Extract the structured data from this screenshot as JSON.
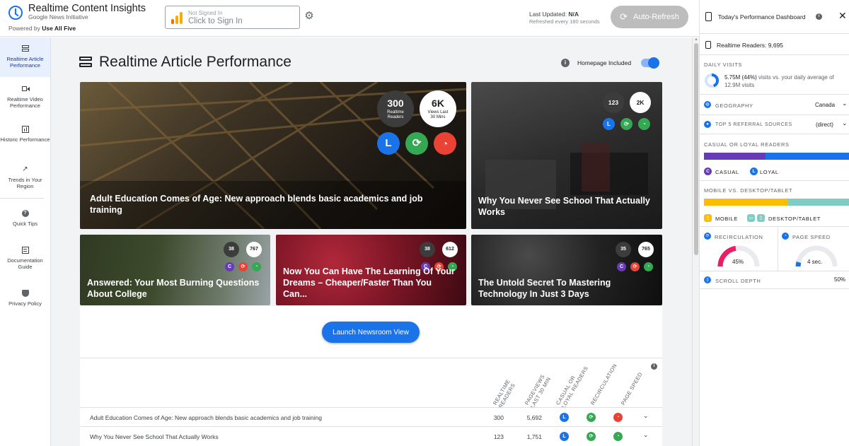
{
  "header": {
    "app_title": "Realtime Content Insights",
    "app_subtitle": "Google News Initiative",
    "powered_prefix": "Powered by",
    "powered_by": "Use All Five",
    "signin_status": "Not Signed In",
    "signin_action": "Click to Sign In",
    "last_updated_label": "Last Updated:",
    "last_updated_value": "N/A",
    "refreshed_text": "Refreshed every 180 seconds",
    "autorefresh_label": "Auto-Refresh"
  },
  "sidebar": {
    "items": [
      {
        "label": "Realtime Article Performance",
        "icon": "article-icon",
        "active": true
      },
      {
        "label": "Realtime Video Performance",
        "icon": "video-icon",
        "active": false
      },
      {
        "label": "Historic Performance",
        "icon": "chart-icon",
        "active": false
      },
      {
        "label": "Trends in Your Region",
        "icon": "trending-icon",
        "active": false
      },
      {
        "label": "Quick Tips",
        "icon": "help-icon",
        "active": false
      },
      {
        "label": "Documentation Guide",
        "icon": "document-icon",
        "active": false
      },
      {
        "label": "Privacy Policy",
        "icon": "shield-icon",
        "active": false
      }
    ]
  },
  "main": {
    "title": "Realtime Article Performance",
    "homepage_label": "Homepage Included",
    "homepage_included": true,
    "launch_label": "Launch Newsroom View",
    "big_card": {
      "title": "Adult Education Comes of Age: New approach blends basic academics and job training",
      "readers": "300",
      "readers_label": "Realtime Readers",
      "views": "6K",
      "views_label": "Views Last 30 Mins",
      "loyalty_letter": "L"
    },
    "cards": [
      {
        "title": "Why You Never See School That Actually Works",
        "readers": "123",
        "views": "2K",
        "letter": "L"
      },
      {
        "title": "Answered: Your Most Burning Questions About College",
        "readers": "38",
        "views": "767",
        "letter": "C"
      },
      {
        "title": "Now You Can Have The Learning Of Your Dreams – Cheaper/Faster Than You Can...",
        "readers": "38",
        "views": "612",
        "letter": "C"
      },
      {
        "title": "The Untold Secret To Mastering Technology In Just 3 Days",
        "readers": "35",
        "views": "765",
        "letter": "C"
      }
    ],
    "table": {
      "columns": [
        "Realtime Readers",
        "Pageviews Last 30 Min",
        "Casual or Loyal Readers",
        "Recirculation",
        "Page Speed"
      ],
      "rows": [
        {
          "title": "Adult Education Comes of Age: New approach blends basic academics and job training",
          "readers": "300",
          "pageviews": "5,692",
          "letter": "L"
        },
        {
          "title": "Why You Never See School That Actually Works",
          "readers": "123",
          "pageviews": "1,751",
          "letter": "L"
        }
      ]
    }
  },
  "panel": {
    "title": "Today's Performance Dashboard",
    "realtime_readers": "Realtime Readers: 9,695",
    "daily_visits_label": "Daily Visits",
    "daily_visits_bold": "5.75M (44%)",
    "daily_visits_text": "visits vs. your daily average of",
    "daily_visits_avg": "12.9M visits",
    "daily_visits_fraction": 0.44,
    "geography_label": "Geography",
    "geography_value": "Canada",
    "referral_label": "Top 5 Referral Sources",
    "referral_value": "(direct)",
    "casual_loyal_label": "Casual or Loyal Readers",
    "casual_fraction": 0.42,
    "casual_label": "Casual",
    "loyal_label": "Loyal",
    "device_label": "Mobile vs. Desktop/Tablet",
    "mobile_fraction": 0.58,
    "mobile_label": "Mobile",
    "desktop_label": "Desktop/Tablet",
    "recirculation_label": "Recirculation",
    "recirculation_value": "45%",
    "recirculation_fraction": 0.45,
    "page_speed_label": "Page Speed",
    "page_speed_value": "4 sec.",
    "scroll_label": "Scroll Depth",
    "scroll_value": "50%"
  },
  "colors": {
    "accent": "#1a73e8",
    "green": "#34a853",
    "red": "#ea4335",
    "purple": "#673ab7",
    "yellow": "#fbbc04",
    "teal": "#80cbc4"
  }
}
